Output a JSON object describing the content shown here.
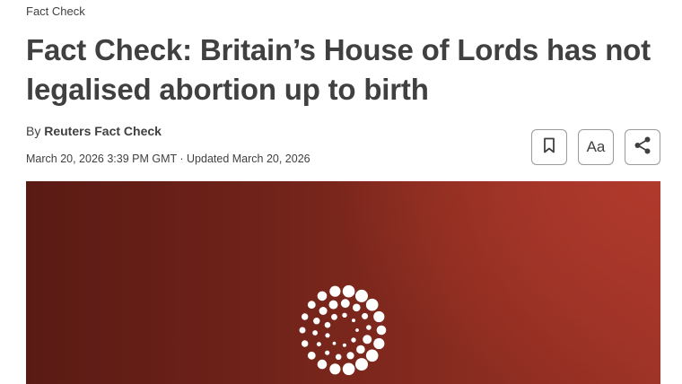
{
  "article": {
    "kicker": "Fact Check",
    "headline": "Fact Check: Britain’s House of Lords has not legalised abortion up to birth",
    "byline_prefix": "By ",
    "author": "Reuters Fact Check",
    "dateline": "March 20, 2026 3:39 PM GMT · Updated March 20, 2026"
  },
  "actions": [
    {
      "name": "bookmark",
      "icon": "bookmark-icon"
    },
    {
      "name": "text-size",
      "label": "Aa"
    },
    {
      "name": "share",
      "icon": "share-icon"
    }
  ],
  "hero": {
    "logo": "reuters-dot-ring-logo",
    "colors": {
      "dark": "#5a1a14",
      "light": "#b03a2c",
      "dots": "#ffffff"
    }
  }
}
